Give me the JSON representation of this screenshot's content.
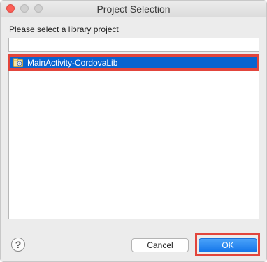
{
  "window": {
    "title": "Project Selection"
  },
  "dialog": {
    "prompt": "Please select a library project",
    "filter": {
      "value": "",
      "placeholder": ""
    },
    "projects": [
      {
        "label": "MainActivity-CordovaLib",
        "icon": "library-project-icon",
        "selected": true
      }
    ]
  },
  "buttons": {
    "help_label": "?",
    "cancel_label": "Cancel",
    "ok_label": "OK"
  },
  "colors": {
    "selection": "#0964d0",
    "highlight_border": "#e2453c",
    "ok_button": "#1677ea"
  }
}
